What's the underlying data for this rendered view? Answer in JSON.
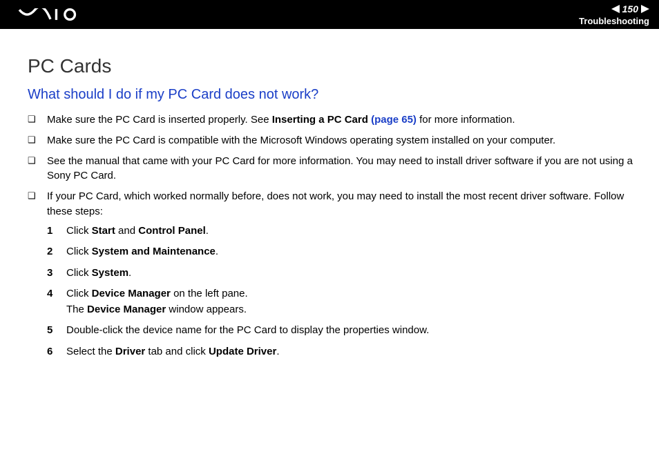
{
  "header": {
    "logo_alt": "VAIO",
    "page_number": "150",
    "section": "Troubleshooting"
  },
  "title": "PC Cards",
  "question": "What should I do if my PC Card does not work?",
  "bullets": [
    {
      "pre": "Make sure the PC Card is inserted properly. See ",
      "bold": "Inserting a PC Card ",
      "link": "(page 65)",
      "post": " for more information."
    },
    {
      "text": "Make sure the PC Card is compatible with the Microsoft Windows operating system installed on your computer."
    },
    {
      "text": "See the manual that came with your PC Card for more information. You may need to install driver software if you are not using a Sony PC Card."
    },
    {
      "text": "If your PC Card, which worked normally before, does not work, you may need to install the most recent driver software. Follow these steps:"
    }
  ],
  "steps": [
    {
      "n": "1",
      "parts": [
        "Click ",
        {
          "b": "Start"
        },
        " and ",
        {
          "b": "Control Panel"
        },
        "."
      ]
    },
    {
      "n": "2",
      "parts": [
        "Click ",
        {
          "b": "System and Maintenance"
        },
        "."
      ]
    },
    {
      "n": "3",
      "parts": [
        "Click ",
        {
          "b": "System"
        },
        "."
      ]
    },
    {
      "n": "4",
      "parts": [
        "Click ",
        {
          "b": "Device Manager"
        },
        " on the left pane.",
        {
          "br": true
        },
        "The ",
        {
          "b": "Device Manager"
        },
        " window appears."
      ]
    },
    {
      "n": "5",
      "parts": [
        "Double-click the device name for the PC Card to display the properties window."
      ]
    },
    {
      "n": "6",
      "parts": [
        "Select the ",
        {
          "b": "Driver"
        },
        " tab and click ",
        {
          "b": "Update Driver"
        },
        "."
      ]
    }
  ]
}
